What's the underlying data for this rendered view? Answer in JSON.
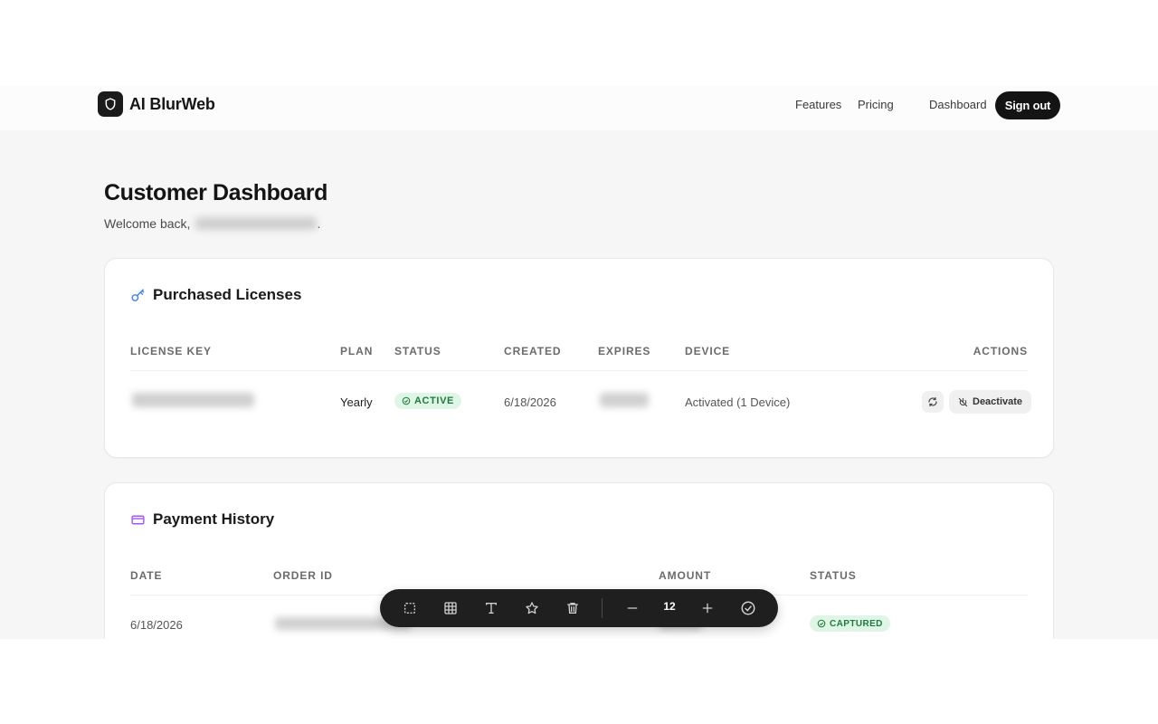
{
  "brand": {
    "name": "AI BlurWeb"
  },
  "nav": {
    "features": "Features",
    "pricing": "Pricing",
    "dashboard": "Dashboard",
    "signout": "Sign out"
  },
  "page": {
    "title": "Customer Dashboard",
    "welcome": "Welcome back,",
    "welcome_end": "."
  },
  "licenses": {
    "title": "Purchased Licenses",
    "columns": [
      "License Key",
      "Plan",
      "Status",
      "Created",
      "Expires",
      "Device",
      "Actions"
    ],
    "rows": [
      {
        "plan": "Yearly",
        "status": "ACTIVE",
        "created": "6/18/2026",
        "device": "Activated (1 Device)",
        "deactivate_label": "Deactivate"
      }
    ]
  },
  "payments": {
    "title": "Payment History",
    "columns": [
      "Date",
      "Order ID",
      "Amount",
      "Status"
    ],
    "rows": [
      {
        "date": "6/18/2026",
        "status": "CAPTURED"
      }
    ]
  },
  "toolbar": {
    "value": "12",
    "tools": [
      "select-region-icon",
      "grid-icon",
      "text-icon",
      "star-icon",
      "trash-icon",
      "minus-icon",
      "plus-icon",
      "check-circle-icon"
    ]
  },
  "colors": {
    "accent_dark": "#141414",
    "success_bg": "#dff6e6",
    "success_fg": "#1e7a3f",
    "key_icon": "#3b82f6",
    "card_icon": "#a855f7"
  }
}
